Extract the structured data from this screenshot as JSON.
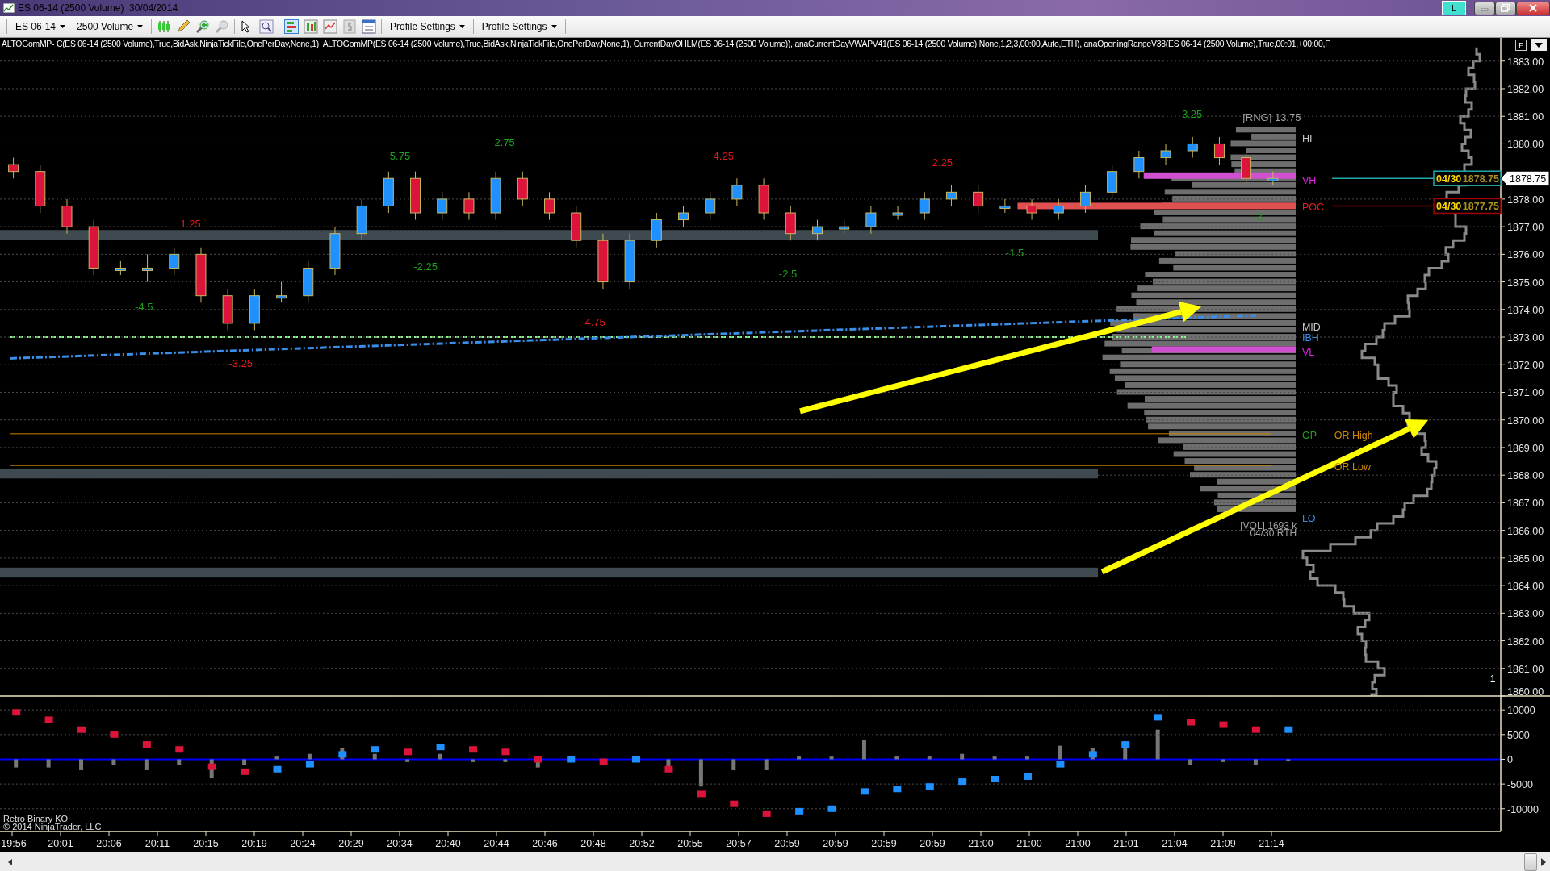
{
  "window": {
    "title": "ES 06-14 (2500 Volume)  30/04/2014",
    "badge": "L"
  },
  "toolbar": {
    "instrument": "ES 06-14",
    "bar_type": "2500 Volume",
    "profile_menus": [
      "Profile Settings",
      "Profile Settings"
    ]
  },
  "indicator_line": {
    "text": "ALTOGomMP- C(ES 06-14 (2500 Volume),True,BidAsk,NinjaTickFile,OnePerDay,None,1), ALTOGomMP(ES 06-14 (2500 Volume),True,BidAsk,NinjaTickFile,OnePerDay,None,1), CurrentDayOHLM(ES 06-14 (2500 Volume)), anaCurrentDayVWAPV41(ES 06-14 (2500 Volume),None,1,2,3,00:00,Auto,ETH), anaOpeningRangeV38(ES 06-14 (2500 Volume),True,00:01,+00:00,F",
    "toggle": "F"
  },
  "price_chart": {
    "chart_data": {
      "type": "candlestick",
      "grid": true,
      "ylim": [
        1860,
        1883.84
      ],
      "categories": [
        null,
        null,
        null,
        null,
        null,
        null,
        null,
        null,
        null,
        null,
        null,
        null,
        null,
        null,
        null,
        null,
        null,
        null,
        null,
        null,
        null,
        null,
        null,
        null,
        null,
        null,
        null,
        null,
        null,
        null,
        null,
        null,
        null,
        null,
        null,
        null,
        null,
        null,
        null,
        null,
        null,
        null,
        null,
        null,
        null,
        null,
        null,
        null,
        null,
        null,
        null,
        null,
        null,
        null,
        null,
        null
      ],
      "yticks": [
        {
          "value": 1860,
          "label": "1860.00"
        },
        {
          "value": 1861,
          "label": "1861.00"
        },
        {
          "value": 1862,
          "label": "1862.00"
        },
        {
          "value": 1863,
          "label": "1863.00"
        },
        {
          "value": 1864,
          "label": "1864.00"
        },
        {
          "value": 1865,
          "label": "1865.00"
        },
        {
          "value": 1866,
          "label": "1866.00"
        },
        {
          "value": 1867,
          "label": "1867.00"
        },
        {
          "value": 1868,
          "label": "1868.00"
        },
        {
          "value": 1869,
          "label": "1869.00"
        },
        {
          "value": 1870,
          "label": "1870.00"
        },
        {
          "value": 1871,
          "label": "1871.00"
        },
        {
          "value": 1872,
          "label": "1872.00"
        },
        {
          "value": 1873,
          "label": "1873.00"
        },
        {
          "value": 1874,
          "label": "1874.00"
        },
        {
          "value": 1875,
          "label": "1875.00"
        },
        {
          "value": 1876,
          "label": "1876.00"
        },
        {
          "value": 1877,
          "label": "1877.00"
        },
        {
          "value": 1878,
          "label": "1878.00"
        },
        {
          "value": 1880,
          "label": "1880.00"
        },
        {
          "value": 1881,
          "label": "1881.00"
        },
        {
          "value": 1882,
          "label": "1882.00"
        },
        {
          "value": 1883,
          "label": "1883.00"
        }
      ],
      "ohlc": [
        [
          1879.25,
          1879.5,
          1878.75,
          1879.0
        ],
        [
          1879.0,
          1879.25,
          1877.5,
          1877.75
        ],
        [
          1877.75,
          1878.0,
          1876.75,
          1877.0
        ],
        [
          1877.0,
          1877.25,
          1875.25,
          1875.5
        ],
        [
          1875.5,
          1875.75,
          1875.25,
          1875.5
        ],
        [
          1875.5,
          1876.0,
          1875.0,
          1875.5
        ],
        [
          1875.5,
          1876.25,
          1875.25,
          1876.0
        ],
        [
          1876.0,
          1876.25,
          1874.25,
          1874.5
        ],
        [
          1874.5,
          1874.75,
          1873.25,
          1873.5
        ],
        [
          1873.5,
          1874.75,
          1873.25,
          1874.5
        ],
        [
          1874.5,
          1875.0,
          1874.25,
          1874.5
        ],
        [
          1874.5,
          1875.75,
          1874.25,
          1875.5
        ],
        [
          1875.5,
          1877.0,
          1875.25,
          1876.75
        ],
        [
          1876.75,
          1878.0,
          1876.5,
          1877.75
        ],
        [
          1877.75,
          1879.0,
          1877.5,
          1878.75
        ],
        [
          1878.75,
          1879.0,
          1877.25,
          1877.5
        ],
        [
          1877.5,
          1878.25,
          1877.25,
          1878.0
        ],
        [
          1878.0,
          1878.25,
          1877.25,
          1877.5
        ],
        [
          1877.5,
          1879.0,
          1877.25,
          1878.75
        ],
        [
          1878.75,
          1879.0,
          1877.75,
          1878.0
        ],
        [
          1878.0,
          1878.25,
          1877.25,
          1877.5
        ],
        [
          1877.5,
          1877.75,
          1876.25,
          1876.5
        ],
        [
          1876.5,
          1876.75,
          1874.75,
          1875.0
        ],
        [
          1875.0,
          1876.75,
          1874.75,
          1876.5
        ],
        [
          1876.5,
          1877.5,
          1876.25,
          1877.25
        ],
        [
          1877.25,
          1877.75,
          1877.0,
          1877.5
        ],
        [
          1877.5,
          1878.25,
          1877.25,
          1878.0
        ],
        [
          1878.0,
          1878.75,
          1877.75,
          1878.5
        ],
        [
          1878.5,
          1878.75,
          1877.25,
          1877.5
        ],
        [
          1877.5,
          1877.75,
          1876.5,
          1876.75
        ],
        [
          1876.75,
          1877.25,
          1876.5,
          1877.0
        ],
        [
          1877.0,
          1877.25,
          1876.75,
          1877.0
        ],
        [
          1877.0,
          1877.75,
          1876.75,
          1877.5
        ],
        [
          1877.5,
          1877.75,
          1877.25,
          1877.5
        ],
        [
          1877.5,
          1878.25,
          1877.25,
          1878.0
        ],
        [
          1878.0,
          1878.5,
          1877.75,
          1878.25
        ],
        [
          1878.25,
          1878.5,
          1877.5,
          1877.75
        ],
        [
          1877.75,
          1878.0,
          1877.5,
          1877.75
        ],
        [
          1877.75,
          1878.0,
          1877.25,
          1877.5
        ],
        [
          1877.5,
          1878.0,
          1877.25,
          1877.75
        ],
        [
          1877.75,
          1878.5,
          1877.5,
          1878.25
        ],
        [
          1878.25,
          1879.25,
          1878.0,
          1879.0
        ],
        [
          1879.0,
          1879.75,
          1878.75,
          1879.5
        ],
        [
          1879.5,
          1880.0,
          1879.25,
          1879.75
        ],
        [
          1879.75,
          1880.25,
          1879.5,
          1880.0
        ],
        [
          1880.0,
          1880.25,
          1879.25,
          1879.5
        ],
        [
          1879.5,
          1879.75,
          1878.5,
          1878.75
        ],
        [
          1878.75,
          1879.0,
          1878.5,
          1878.75
        ],
        null,
        null,
        null,
        null,
        null,
        null,
        null,
        null
      ]
    },
    "labels": [
      {
        "kind": "swing",
        "text": "3.25",
        "color": "#1ea01e"
      },
      {
        "kind": "swing",
        "text": "[RNG] 13.75",
        "color": "#a0a0a0"
      },
      {
        "kind": "level",
        "text": "HI",
        "color": "#c8c8c8"
      },
      {
        "kind": "swing",
        "text": "2.75",
        "color": "#1ea01e"
      },
      {
        "kind": "swing",
        "text": "5.75",
        "color": "#1ea01e"
      },
      {
        "kind": "swing",
        "text": "4.25",
        "color": "#e01818"
      },
      {
        "kind": "swing",
        "text": "2.25",
        "color": "#e01818"
      },
      {
        "kind": "level",
        "text": "VH",
        "color": "#e020e0"
      },
      {
        "kind": "level",
        "text": "POC",
        "color": "#e02020"
      },
      {
        "kind": "swing",
        "text": "-2",
        "color": "#1ea01e"
      },
      {
        "kind": "swing",
        "text": "1.25",
        "color": "#e01818"
      },
      {
        "kind": "swing",
        "text": "-1.5",
        "color": "#1ea01e"
      },
      {
        "kind": "swing",
        "text": "-2.25",
        "color": "#1ea01e"
      },
      {
        "kind": "swing",
        "text": "-2.5",
        "color": "#1ea01e"
      },
      {
        "kind": "swing",
        "text": "-4.5",
        "color": "#1ea01e"
      },
      {
        "kind": "swing",
        "text": "-4.75",
        "color": "#e01818"
      },
      {
        "kind": "level",
        "text": "MID",
        "color": "#c8c8c8"
      },
      {
        "kind": "level",
        "text": "IBH",
        "color": "#3a8ee8"
      },
      {
        "kind": "level",
        "text": "VL",
        "color": "#e020e0"
      },
      {
        "kind": "swing",
        "text": "-3.25",
        "color": "#e01818"
      },
      {
        "kind": "level",
        "text": "OP",
        "color": "#1ea01e"
      },
      {
        "kind": "level",
        "text": "OR High",
        "color": "#d08a00"
      },
      {
        "kind": "level",
        "text": "OR Low",
        "color": "#d08a00"
      },
      {
        "kind": "level",
        "text": "LO",
        "color": "#3a8ee8"
      },
      {
        "kind": "note",
        "text": "[VOL] 1693 k",
        "color": "#a0a0a0"
      },
      {
        "kind": "note",
        "text": "04/30 RTH",
        "color": "#a0a0a0"
      },
      {
        "kind": "note",
        "text": "1",
        "color": "#ffffff"
      }
    ],
    "price_markers": [
      {
        "kind": "vh",
        "date": "04/30",
        "price": "1878.75"
      },
      {
        "kind": "poc",
        "date": "04/30",
        "price": "1877.75"
      }
    ],
    "last_price": "1878.75"
  },
  "delta_chart": {
    "chart_data": {
      "type": "scatter",
      "grid": true,
      "ylim": [
        -14600,
        12800
      ],
      "categories": [
        null,
        null,
        null,
        null,
        null,
        null,
        null,
        null,
        null,
        null,
        null,
        null,
        null,
        null,
        null,
        null,
        null,
        null,
        null,
        null,
        null,
        null,
        null,
        null,
        null,
        null,
        null,
        null,
        null,
        null,
        null,
        null,
        null,
        null,
        null,
        null,
        null,
        null,
        null,
        null,
        null,
        null,
        null,
        null,
        null,
        null
      ],
      "yticks": [
        {
          "value": 10000,
          "label": "10000"
        },
        {
          "value": 5000,
          "label": "5000"
        },
        {
          "value": 0,
          "label": "0"
        },
        {
          "value": -5000,
          "label": "-5000"
        },
        {
          "value": -10000,
          "label": "-10000"
        }
      ],
      "series": [
        {
          "color": "#1e90ff",
          "values": [
            null,
            null,
            null,
            null,
            null,
            null,
            null,
            null,
            -2000,
            -1000,
            1000,
            2000,
            null,
            2500,
            null,
            null,
            null,
            0,
            null,
            0,
            null,
            null,
            null,
            null,
            -10500,
            -10000,
            -6500,
            -6000,
            -5500,
            -4500,
            -4000,
            -3500,
            -1000,
            1000,
            3000,
            8500,
            null,
            null,
            null,
            6000,
            null,
            null,
            null,
            null,
            null,
            null
          ]
        },
        {
          "color": "#dc143c",
          "values": [
            9500,
            8000,
            6000,
            5000,
            3000,
            2000,
            -1500,
            -2500,
            null,
            null,
            null,
            null,
            1500,
            null,
            2000,
            1500,
            0,
            null,
            -500,
            null,
            -2000,
            -7000,
            -9000,
            -11000,
            null,
            null,
            null,
            null,
            null,
            null,
            null,
            null,
            null,
            null,
            null,
            null,
            7500,
            7000,
            6000,
            null,
            null,
            null,
            null,
            null,
            null,
            null
          ]
        }
      ]
    },
    "notes": [
      "Retro Binary KO",
      "© 2014 NinjaTrader, LLC"
    ]
  },
  "time_axis": [
    "19:56",
    "20:01",
    "20:06",
    "20:11",
    "20:15",
    "20:19",
    "20:24",
    "20:29",
    "20:34",
    "20:40",
    "20:44",
    "20:46",
    "20:48",
    "20:52",
    "20:55",
    "20:57",
    "20:59",
    "20:59",
    "20:59",
    "20:59",
    "21:00",
    "21:00",
    "21:00",
    "21:01",
    "21:04",
    "21:09",
    "21:14"
  ]
}
